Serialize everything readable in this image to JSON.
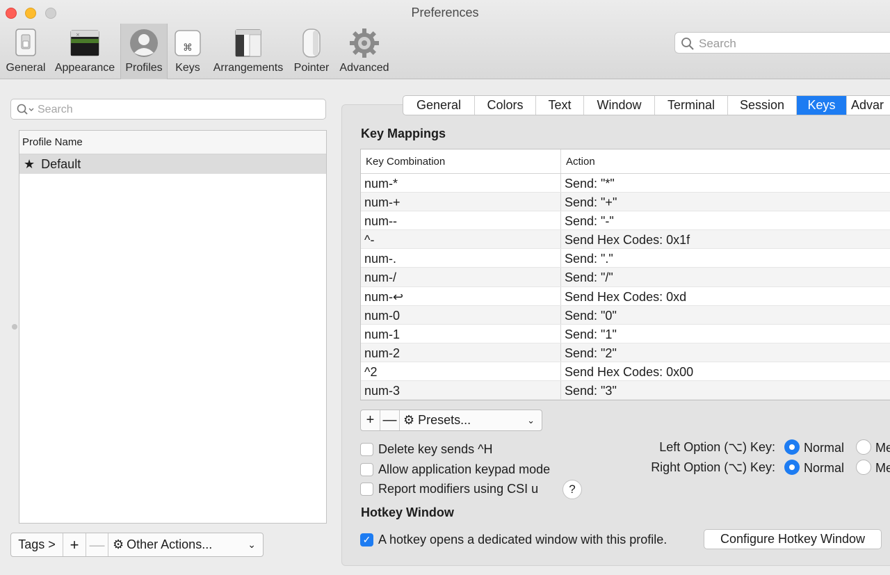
{
  "window": {
    "title": "Preferences"
  },
  "toolbar": {
    "items": [
      {
        "label": "General",
        "icon": "switch-icon"
      },
      {
        "label": "Appearance",
        "icon": "terminal-window-icon"
      },
      {
        "label": "Profiles",
        "icon": "person-icon",
        "selected": true
      },
      {
        "label": "Keys",
        "icon": "command-key-icon"
      },
      {
        "label": "Arrangements",
        "icon": "window-arrangement-icon"
      },
      {
        "label": "Pointer",
        "icon": "mouse-icon"
      },
      {
        "label": "Advanced",
        "icon": "gear-icon"
      }
    ],
    "search_placeholder": "Search"
  },
  "profiles": {
    "search_placeholder": "Search",
    "column_header": "Profile Name",
    "items": [
      {
        "name": "Default",
        "starred": true
      }
    ],
    "tags_label": "Tags >",
    "add_label": "+",
    "remove_label": "—",
    "other_actions_label": "Other Actions..."
  },
  "tabs": [
    "General",
    "Colors",
    "Text",
    "Window",
    "Terminal",
    "Session",
    "Keys",
    "Advar"
  ],
  "active_tab": "Keys",
  "key_mappings": {
    "title": "Key Mappings",
    "headers": [
      "Key Combination",
      "Action"
    ],
    "rows": [
      [
        "num-*",
        "Send: \"*\""
      ],
      [
        "num-+",
        "Send: \"+\""
      ],
      [
        "num--",
        "Send: \"-\""
      ],
      [
        "^-",
        "Send Hex Codes: 0x1f"
      ],
      [
        "num-.",
        "Send: \".\""
      ],
      [
        "num-/",
        "Send: \"/\""
      ],
      [
        "num-↩",
        "Send Hex Codes: 0xd"
      ],
      [
        "num-0",
        "Send: \"0\""
      ],
      [
        "num-1",
        "Send: \"1\""
      ],
      [
        "num-2",
        "Send: \"2\""
      ],
      [
        "^2",
        "Send Hex Codes: 0x00"
      ],
      [
        "num-3",
        "Send: \"3\""
      ]
    ],
    "add_label": "+",
    "remove_label": "—",
    "presets_label": "Presets..."
  },
  "options": {
    "delete_key": "Delete key sends ^H",
    "app_keypad": "Allow application keypad mode",
    "report_modifiers": "Report modifiers using CSI u",
    "help_label": "?",
    "left_option_label": "Left Option (⌥) Key:",
    "right_option_label": "Right Option (⌥) Key:",
    "normal_label": "Normal",
    "meta_label": "Me"
  },
  "hotkey": {
    "title": "Hotkey Window",
    "checkbox_label": "A hotkey opens a dedicated window with this profile.",
    "checkbox_checked": true,
    "configure_label": "Configure Hotkey Window"
  },
  "colors": {
    "accent": "#1d7cf2"
  }
}
